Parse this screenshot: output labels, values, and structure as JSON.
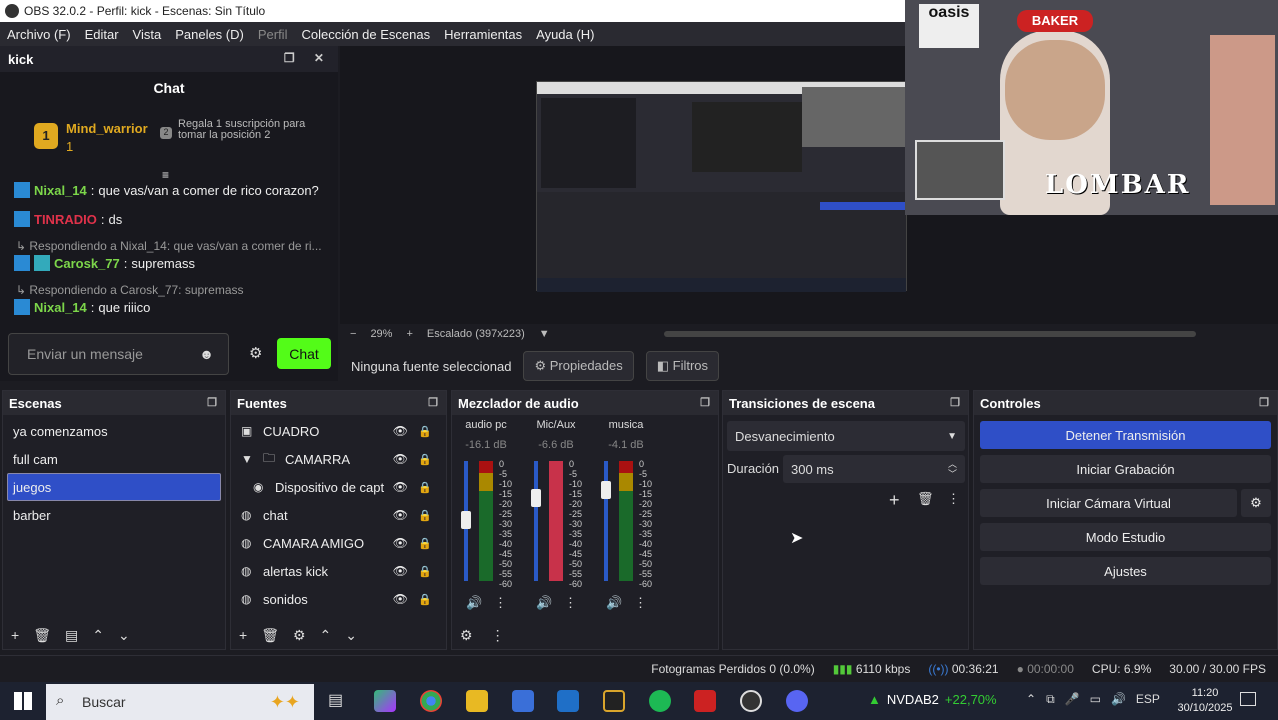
{
  "window": {
    "title": "OBS 32.0.2 - Perfil: kick - Escenas: Sin Título"
  },
  "menu": [
    "Archivo (F)",
    "Editar",
    "Vista",
    "Paneles (D)",
    "Perfil",
    "Colección de Escenas",
    "Herramientas",
    "Ayuda (H)"
  ],
  "chat": {
    "dock_title": "kick",
    "title": "Chat",
    "leader": {
      "rank": "1",
      "name": "Mind_warrior",
      "count": "1"
    },
    "gift": {
      "rank": "2",
      "text": "Regala 1 suscripción para tomar la posición 2"
    },
    "messages": [
      {
        "user": "Nixal_14",
        "text": "que vas/van a comer de rico corazon?",
        "color": "#7cd64a"
      },
      {
        "user": "TINRADIO",
        "text": "ds",
        "color": "#e0324a"
      },
      {
        "reply": "Respondiendo a Nixal_14: que vas/van a comer de ri..."
      },
      {
        "user": "Carosk_77",
        "text": "supremass",
        "color": "#7cd64a"
      },
      {
        "reply": "Respondiendo a Carosk_77: supremass"
      },
      {
        "user": "Nixal_14",
        "text": "que riiico",
        "color": "#7cd64a"
      }
    ],
    "input_placeholder": "Enviar un mensaje",
    "send_label": "Chat"
  },
  "preview": {
    "zoom": "29%",
    "scale": "Escalado (397x223)",
    "cam_overlay_text": "LOMBAR",
    "sticker_baker": "BAKER",
    "sticker_oasis": "oasis"
  },
  "source_bar": {
    "none_selected": "Ninguna fuente seleccionad",
    "properties": "Propiedades",
    "filters": "Filtros"
  },
  "scenes": {
    "title": "Escenas",
    "items": [
      "ya comenzamos",
      "full cam",
      "juegos",
      "barber"
    ],
    "selected": 2
  },
  "sources": {
    "title": "Fuentes",
    "items": [
      {
        "label": "CUADRO",
        "icon": "image-icon"
      },
      {
        "label": "CAMARRA",
        "icon": "folder-icon"
      },
      {
        "label": "Dispositivo de capt",
        "icon": "camera-icon"
      },
      {
        "label": "chat",
        "icon": "browser-icon"
      },
      {
        "label": "CAMARA AMIGO",
        "icon": "browser-icon"
      },
      {
        "label": "alertas kick",
        "icon": "browser-icon"
      },
      {
        "label": "sonidos",
        "icon": "browser-icon"
      }
    ]
  },
  "mixer": {
    "title": "Mezclador de audio",
    "channels": [
      {
        "name": "audio pc",
        "db": "-16.1 dB",
        "level": 0.55
      },
      {
        "name": "Mic/Aux",
        "db": "-6.6 dB",
        "level": 0.72
      },
      {
        "name": "musica",
        "db": "-4.1 dB",
        "level": 0.78
      }
    ],
    "scale": [
      "0",
      "-5",
      "-10",
      "-15",
      "-20",
      "-25",
      "-30",
      "-35",
      "-40",
      "-45",
      "-50",
      "-55",
      "-60"
    ]
  },
  "transitions": {
    "title": "Transiciones de escena",
    "selected": "Desvanecimiento",
    "duration_label": "Duración",
    "duration": "300 ms"
  },
  "controls": {
    "title": "Controles",
    "stop_stream": "Detener Transmisión",
    "start_rec": "Iniciar Grabación",
    "virtual_cam": "Iniciar Cámara Virtual",
    "studio": "Modo Estudio",
    "settings": "Ajustes",
    "accent": "#2f4fc7"
  },
  "status": {
    "dropped": "Fotogramas Perdidos 0 (0.0%)",
    "kbps": "6110 kbps",
    "stream_time": "00:36:21",
    "rec_time": "00:00:00",
    "cpu": "CPU: 6.9%",
    "fps": "30.00 / 30.00 FPS"
  },
  "taskbar": {
    "search": "Buscar",
    "stock": "NVDAB2",
    "stock_change": "+22,70%",
    "lang": "ESP",
    "time": "11:20",
    "date": "30/10/2025"
  }
}
